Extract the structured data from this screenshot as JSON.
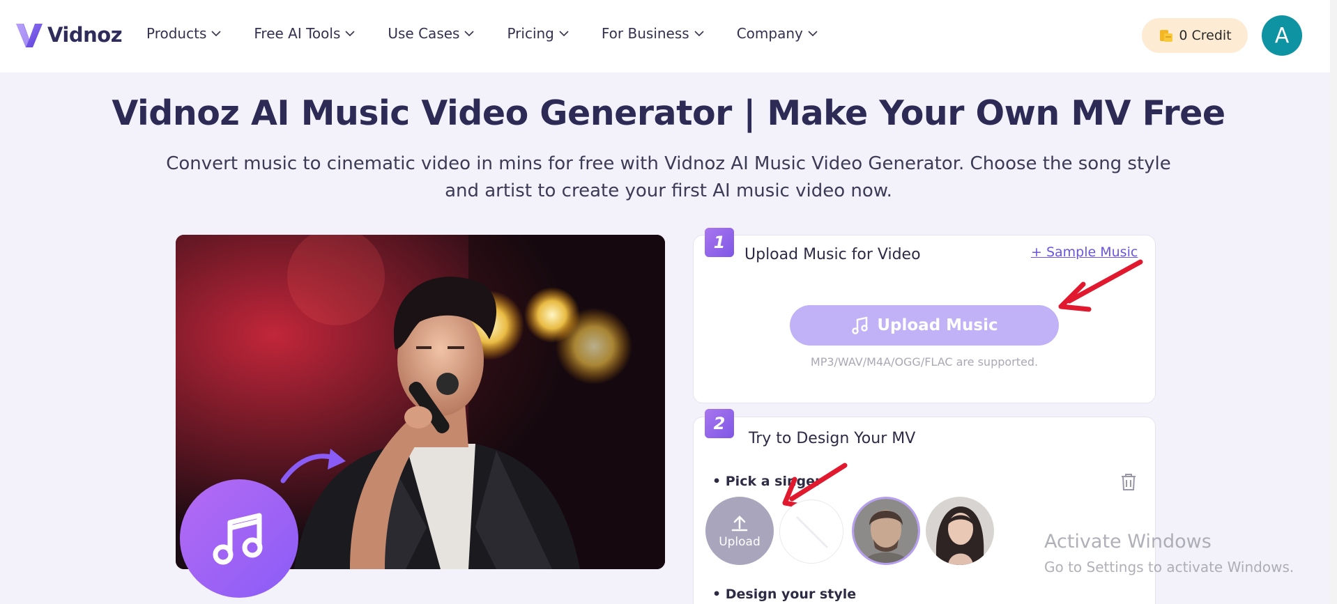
{
  "header": {
    "logo_text": "Vidnoz",
    "nav": [
      "Products",
      "Free AI Tools",
      "Use Cases",
      "Pricing",
      "For Business",
      "Company"
    ],
    "credit_label": "0 Credit",
    "avatar_letter": "A"
  },
  "hero": {
    "title": "Vidnoz AI Music Video Generator | Make Your Own MV Free",
    "subtitle": "Convert music to cinematic video in mins for free with Vidnoz AI Music Video Generator. Choose the song style and artist to create your first AI music video now."
  },
  "step1": {
    "number": "1",
    "title": "Upload Music for Video",
    "sample_link": "+ Sample Music",
    "upload_button": "Upload Music",
    "supported_formats": "MP3/WAV/M4A/OGG/FLAC are supported."
  },
  "step2": {
    "number": "2",
    "title": "Try to Design Your MV",
    "pick_singer_label": "• Pick a singer",
    "upload_label": "Upload",
    "design_style_label": "• Design your style"
  },
  "watermark": {
    "line1": "Activate Windows",
    "line2": "Go to Settings to activate Windows."
  },
  "colors": {
    "accent": "#8a5cf6",
    "upload_button": "#c1b2f7",
    "avatar_bg": "#0e93a3",
    "credit_bg": "#fdebd3",
    "annotation_red": "#e0192e"
  }
}
